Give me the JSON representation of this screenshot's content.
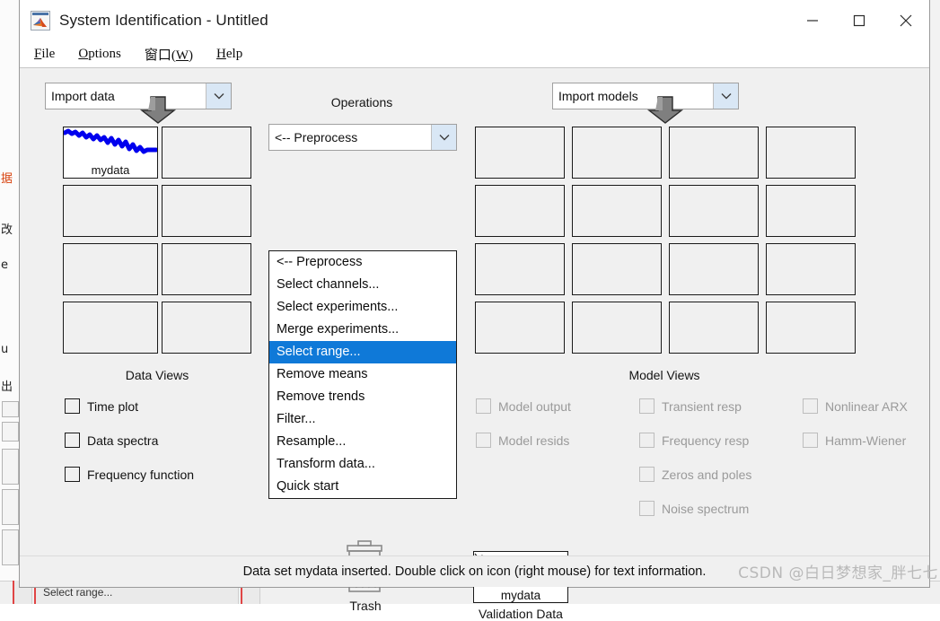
{
  "window": {
    "title": "System Identification - Untitled",
    "app_icon": "matlab-icon",
    "controls": {
      "minimize": "minimize-icon",
      "maximize": "maximize-icon",
      "close": "close-icon"
    }
  },
  "menubar": {
    "items": [
      {
        "label": "File",
        "mnemonic": "F"
      },
      {
        "label": "Options",
        "mnemonic": "O"
      },
      {
        "label": "窗口(W)",
        "mnemonic": "W"
      },
      {
        "label": "Help",
        "mnemonic": "H"
      }
    ]
  },
  "data_panel": {
    "import_combo": {
      "value": "Import data",
      "arrow": "chevron-down-icon"
    },
    "arrow_icon": "down-arrow-icon",
    "cells": [
      {
        "label": "mydata",
        "filled": true
      },
      {
        "label": "",
        "filled": false
      },
      {
        "label": "",
        "filled": false
      },
      {
        "label": "",
        "filled": false
      },
      {
        "label": "",
        "filled": false
      },
      {
        "label": "",
        "filled": false
      },
      {
        "label": "",
        "filled": false
      },
      {
        "label": "",
        "filled": false
      }
    ],
    "views_title": "Data Views",
    "views": [
      {
        "label": "Time plot",
        "checked": false,
        "disabled": false
      },
      {
        "label": "Data spectra",
        "checked": false,
        "disabled": false
      },
      {
        "label": "Frequency function",
        "checked": false,
        "disabled": false
      }
    ]
  },
  "operations": {
    "title": "Operations",
    "combo": {
      "value": "<-- Preprocess",
      "arrow": "chevron-down-icon"
    },
    "menu_open": true,
    "menu_items": [
      {
        "label": "<-- Preprocess",
        "selected": false
      },
      {
        "label": "Select channels...",
        "selected": false
      },
      {
        "label": "Select experiments...",
        "selected": false
      },
      {
        "label": "Merge experiments...",
        "selected": false
      },
      {
        "label": "Select range...",
        "selected": true
      },
      {
        "label": "Remove means",
        "selected": false
      },
      {
        "label": "Remove trends",
        "selected": false
      },
      {
        "label": "Filter...",
        "selected": false
      },
      {
        "label": "Resample...",
        "selected": false
      },
      {
        "label": "Transform data...",
        "selected": false
      },
      {
        "label": "Quick start",
        "selected": false
      }
    ],
    "trash": {
      "label": "Trash",
      "icon": "trash-icon"
    }
  },
  "model_panel": {
    "import_combo": {
      "value": "Import models",
      "arrow": "chevron-down-icon"
    },
    "arrow_icon": "down-arrow-icon",
    "cells_rows": 4,
    "cells_cols": 4,
    "views_title": "Model Views",
    "views_col1": [
      {
        "label": "Model output",
        "checked": false,
        "disabled": true
      },
      {
        "label": "Model resids",
        "checked": false,
        "disabled": true
      }
    ],
    "views_col2": [
      {
        "label": "Transient resp",
        "checked": false,
        "disabled": true
      },
      {
        "label": "Frequency resp",
        "checked": false,
        "disabled": true
      },
      {
        "label": "Zeros and poles",
        "checked": false,
        "disabled": true
      },
      {
        "label": "Noise spectrum",
        "checked": false,
        "disabled": true
      }
    ],
    "views_col3": [
      {
        "label": "Nonlinear ARX",
        "checked": false,
        "disabled": true
      },
      {
        "label": "Hamm-Wiener",
        "checked": false,
        "disabled": true
      }
    ]
  },
  "validation": {
    "thumb_label": "mydata",
    "caption": "Validation Data"
  },
  "statusbar": {
    "text": "Data set mydata inserted.  Double click on icon (right mouse) for text information."
  },
  "watermark": {
    "text": "CSDN @白日梦想家_胖七七"
  },
  "background": {
    "taskbar_item": "Select range...",
    "side_glyphs": [
      "据",
      "改",
      "e",
      "u",
      "出"
    ]
  },
  "colors": {
    "window_bg": "#f0f0f0",
    "titlebar_bg": "#ffffff",
    "highlight": "#0f79d8",
    "thumb_line": "#0000ee",
    "cell_border": "#1a1a1a",
    "disabled_text": "#9a9a9a"
  }
}
